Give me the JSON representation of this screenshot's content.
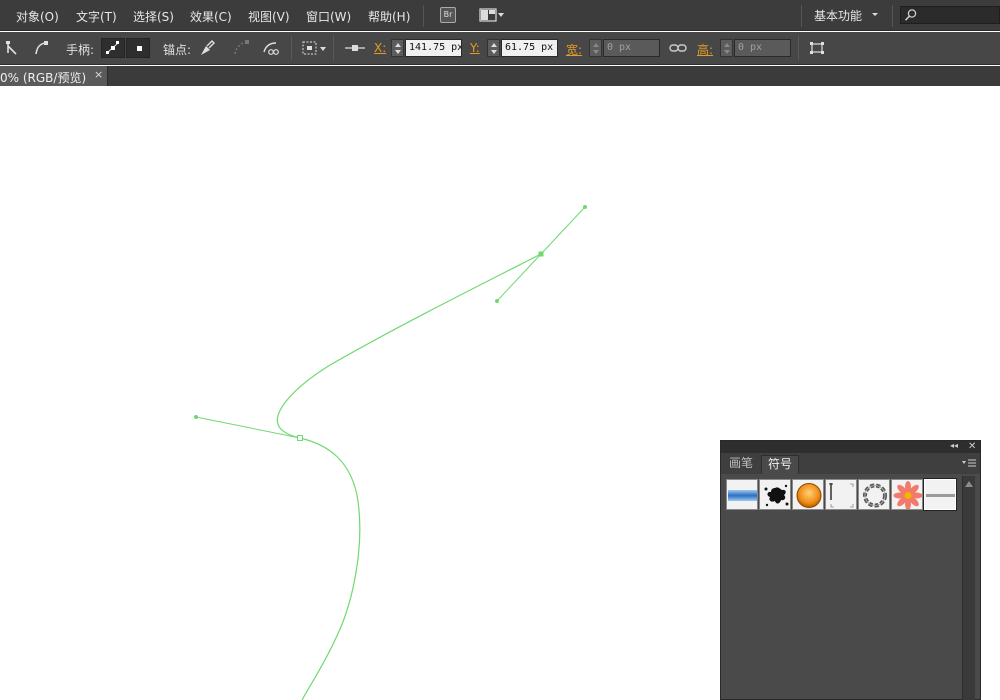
{
  "menu": {
    "items": [
      "对象(O)",
      "文字(T)",
      "选择(S)",
      "效果(C)",
      "视图(V)",
      "窗口(W)",
      "帮助(H)"
    ],
    "bridge_label": "Br",
    "workspace": "基本功能"
  },
  "control": {
    "handles_label": "手柄:",
    "anchor_label": "锚点:",
    "x_label": "X:",
    "x_value": "141.75 px",
    "y_label": "Y:",
    "y_value": "61.75 px",
    "w_label": "宽:",
    "w_value": "0 px",
    "h_label": "高:",
    "h_value": "0 px"
  },
  "document": {
    "tab_label": "0% (RGB/预览)",
    "close_glyph": "×"
  },
  "panel": {
    "tabs": [
      "画笔",
      "符号"
    ],
    "active_tab": "符号",
    "collapse_glyph": "◂◂",
    "close_glyph": "✕",
    "symbols": [
      "blue-banner",
      "ink-splat",
      "orange-orb",
      "grid-corners",
      "dashed-ring",
      "pink-flower",
      "gray-line"
    ]
  },
  "colors": {
    "path_stroke": "#6fd96f",
    "accent_orange": "#e39a27"
  }
}
